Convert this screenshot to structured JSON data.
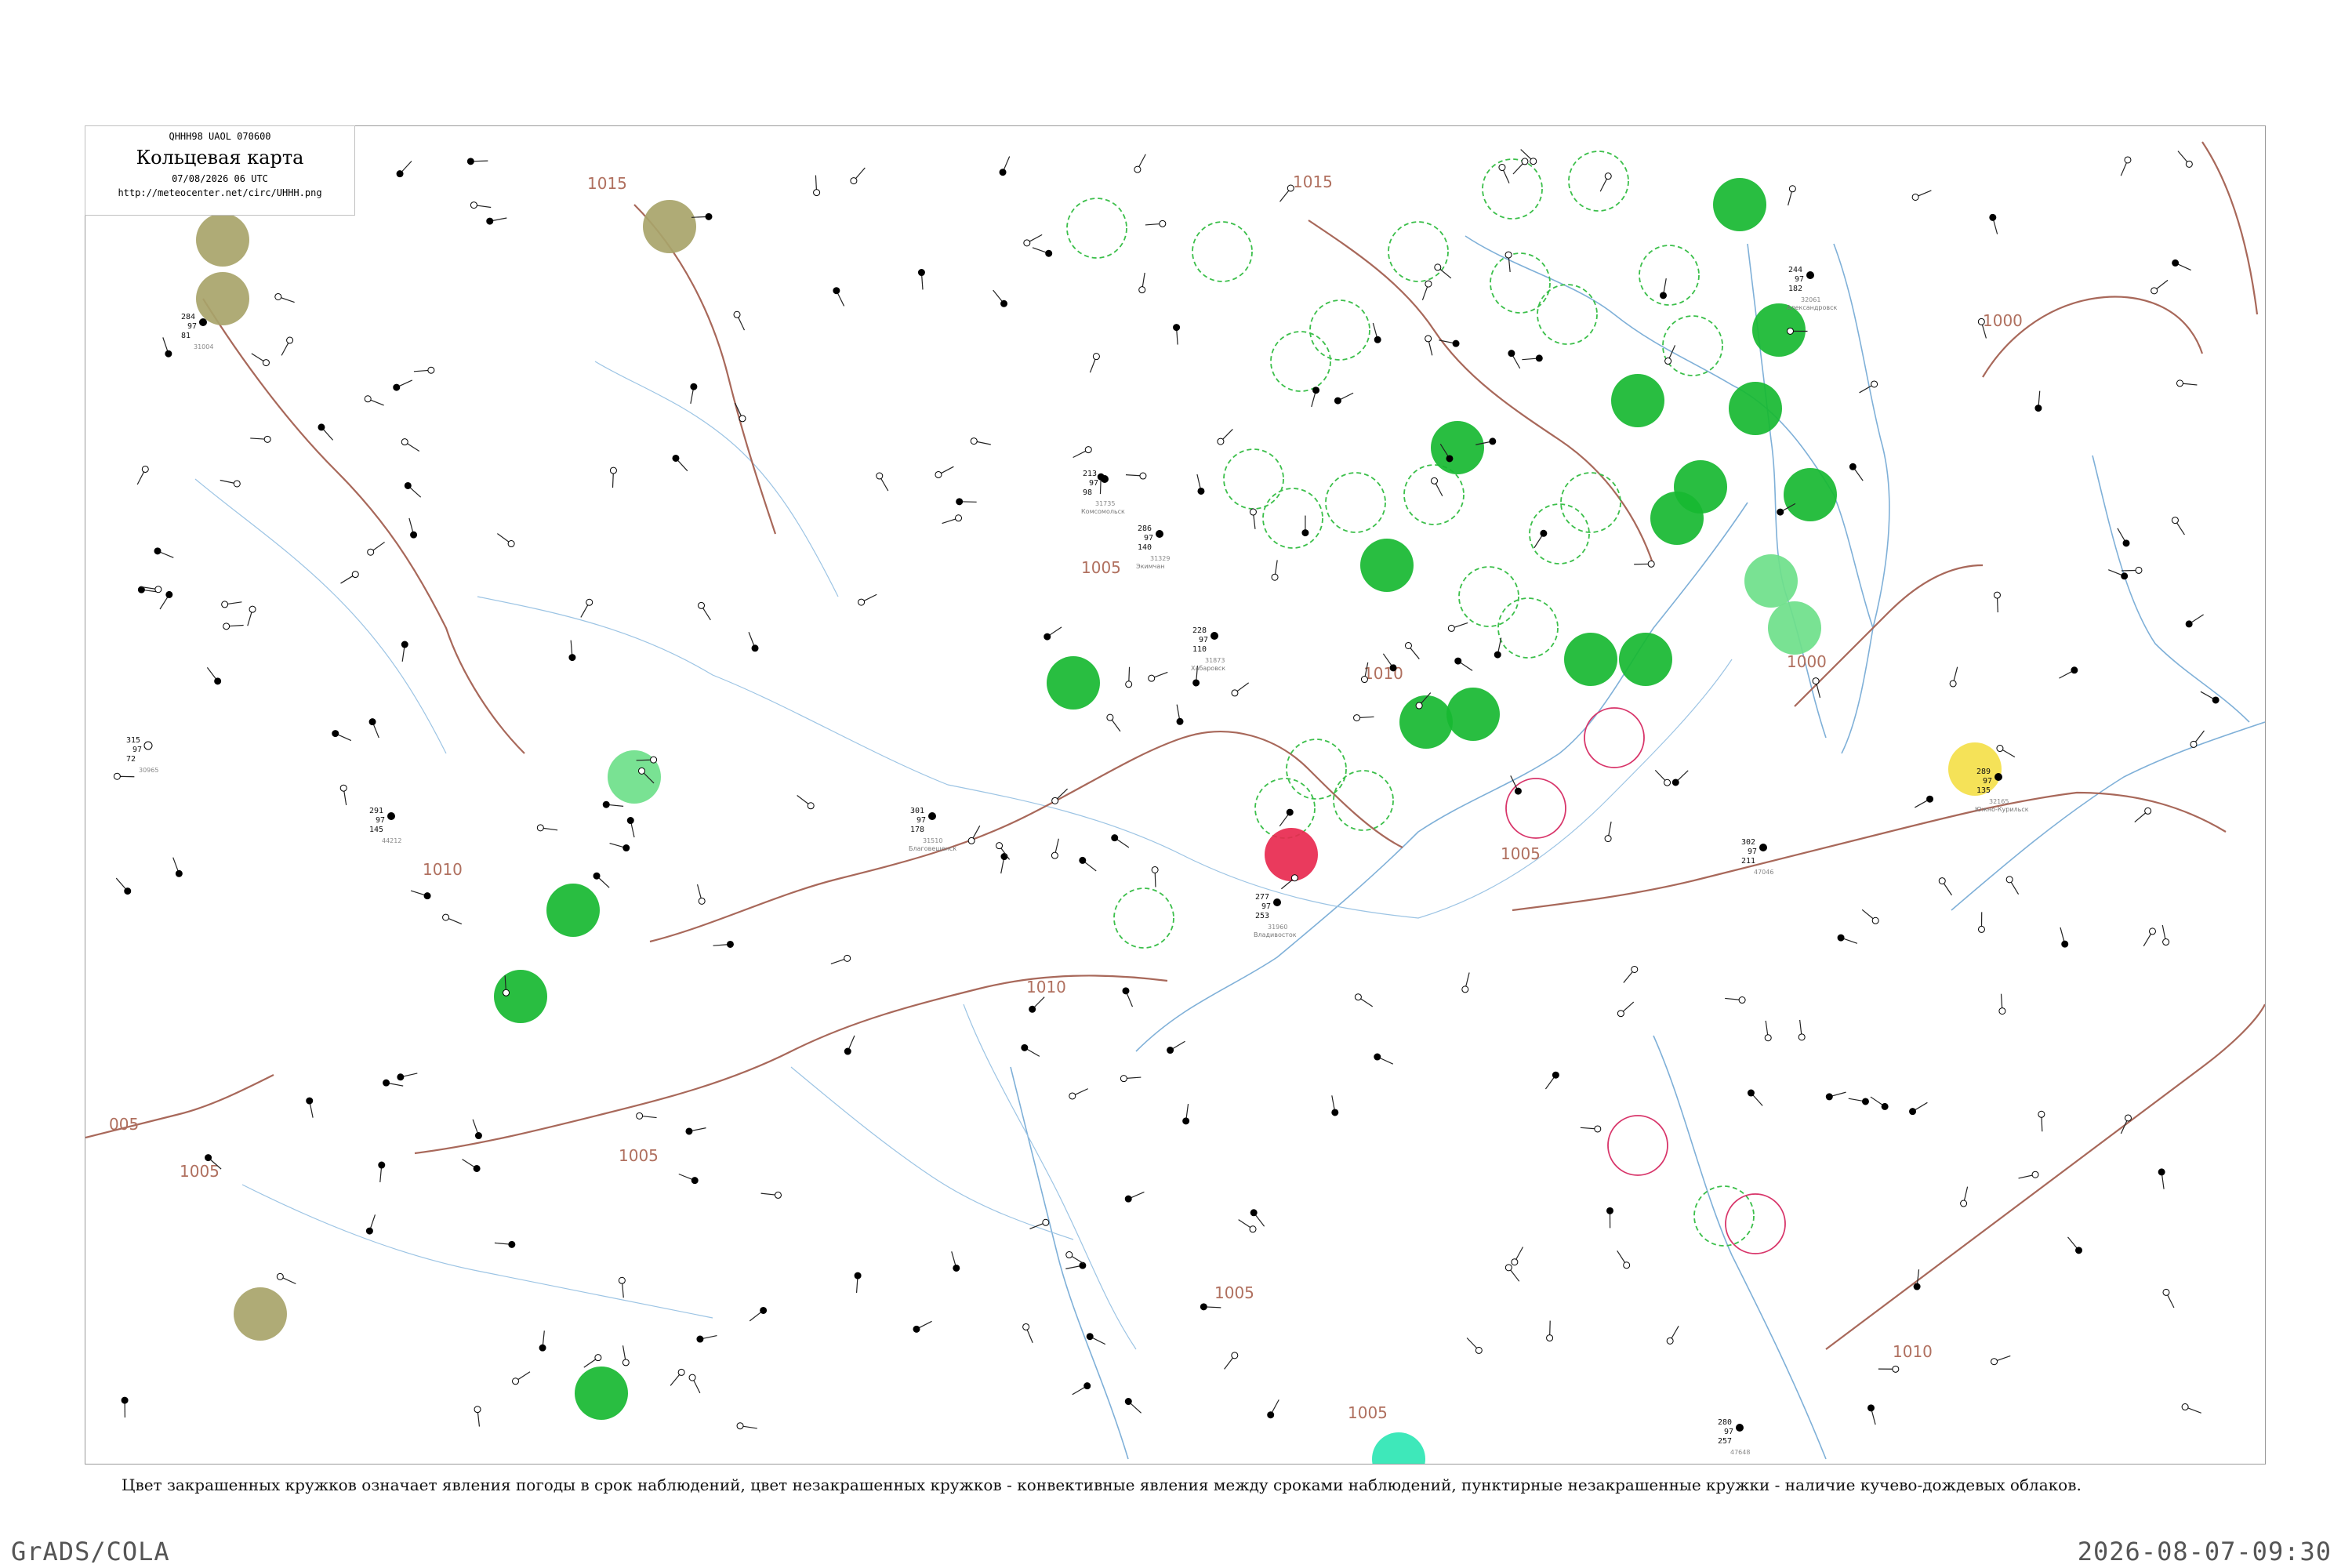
{
  "header": {
    "product_code": "QHHH98  UAOL  070600",
    "title": "Кольцевая карта",
    "datetime": "07/08/2026 06 UTC",
    "source_url": "http://meteocenter.net/circ/UHHH.png"
  },
  "legend_caption": "Цвет закрашенных кружков означает явления погоды в срок наблюдений, цвет незакрашенных кружков - конвективные явления между сроками наблюдений, пунктирные незакрашенные кружки - наличие кучево-дождевых облаков.",
  "footer": {
    "software": "GrADS/COLA",
    "timestamp": "2026-08-07-09:30"
  },
  "colors": {
    "isobar": "#a8685a",
    "coast": "#7fb0d8",
    "rain": "#17b831",
    "shower": "#6ee08a",
    "thunder": "#e8294f",
    "fog": "#a8a46a",
    "mist": "#f4e04a",
    "drizzle": "#2ee6b4",
    "convective_ring": "#d8356a",
    "cb_ring": "#3bbf4a"
  },
  "isobar_labels": [
    "1015",
    "1015",
    "1010",
    "1010",
    "1010",
    "1005",
    "1005",
    "1005",
    "1005",
    "1005",
    "1000",
    "1000",
    "1000",
    "1010",
    "005",
    "1005"
  ],
  "stations": [
    {
      "id": "31873",
      "t": "228",
      "p": "97",
      "tp": "110",
      "place": "Хабаровск"
    },
    {
      "id": "31735",
      "t": "213",
      "p": "97",
      "tp": "98",
      "place": "Комсомольск"
    },
    {
      "id": "32165",
      "t": "289",
      "p": "97",
      "tp": "135",
      "place": "Южно-Курильск"
    },
    {
      "id": "47648",
      "t": "280",
      "p": "97",
      "tp": "257",
      "place": ""
    },
    {
      "id": "30965",
      "t": "315",
      "p": "97",
      "tp": "72",
      "place": ""
    },
    {
      "id": "31510",
      "t": "301",
      "p": "97",
      "tp": "178",
      "place": "Благовещенск"
    },
    {
      "id": "31329",
      "t": "286",
      "p": "97",
      "tp": "140",
      "place": "Экимчан"
    },
    {
      "id": "32061",
      "t": "244",
      "p": "97",
      "tp": "182",
      "place": "Александровск"
    },
    {
      "id": "31960",
      "t": "277",
      "p": "97",
      "tp": "253",
      "place": "Владивосток"
    },
    {
      "id": "47046",
      "t": "302",
      "p": "97",
      "tp": "211",
      "place": ""
    },
    {
      "id": "31004",
      "t": "284",
      "p": "97",
      "tp": "81",
      "place": ""
    },
    {
      "id": "44212",
      "t": "291",
      "p": "97",
      "tp": "145",
      "place": ""
    }
  ]
}
